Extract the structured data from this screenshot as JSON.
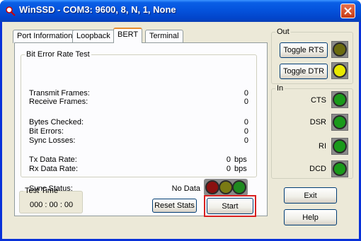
{
  "window": {
    "title": "WinSSD - COM3: 9600, 8, N, 1, None"
  },
  "tabs": [
    {
      "label": "Port Information",
      "active": false
    },
    {
      "label": "Loopback",
      "active": false
    },
    {
      "label": "BERT",
      "active": true
    },
    {
      "label": "Terminal",
      "active": false
    }
  ],
  "bert": {
    "group_title": "Bit Error Rate Test",
    "transmit_frames": {
      "label": "Transmit Frames:",
      "value": "0"
    },
    "receive_frames": {
      "label": "Receive Frames:",
      "value": "0"
    },
    "bytes_checked": {
      "label": "Bytes Checked:",
      "value": "0"
    },
    "bit_errors": {
      "label": "Bit Errors:",
      "value": "0"
    },
    "sync_losses": {
      "label": "Sync Losses:",
      "value": "0"
    },
    "tx_rate": {
      "label": "Tx Data Rate:",
      "value": "0",
      "unit": "bps"
    },
    "rx_rate": {
      "label": "Rx Data Rate:",
      "value": "0",
      "unit": "bps"
    },
    "sync_status": {
      "label": "Sync Status:",
      "value": "No Data"
    },
    "sync_leds": [
      "#8b1010",
      "#7a7a14",
      "#1f8a1f"
    ]
  },
  "test_time": {
    "title": "Test Time",
    "value": "000 : 00 : 00"
  },
  "buttons": {
    "reset_stats": "Reset Stats",
    "start": "Start",
    "exit": "Exit",
    "help": "Help"
  },
  "out_group": {
    "title": "Out",
    "toggle_rts": "Toggle RTS",
    "toggle_dtr": "Toggle DTR",
    "rts_led_color": "#6b6b10",
    "dtr_led_color": "#e8e800"
  },
  "in_group": {
    "title": "In",
    "signals": [
      {
        "label": "CTS",
        "color": "#1a9a1a"
      },
      {
        "label": "DSR",
        "color": "#1a9a1a"
      },
      {
        "label": "RI",
        "color": "#1a9a1a"
      },
      {
        "label": "DCD",
        "color": "#1a9a1a"
      }
    ]
  },
  "colors": {
    "title_bar": "#0453dd",
    "dialog_bg": "#ece9d8",
    "start_highlight": "#d92020"
  }
}
